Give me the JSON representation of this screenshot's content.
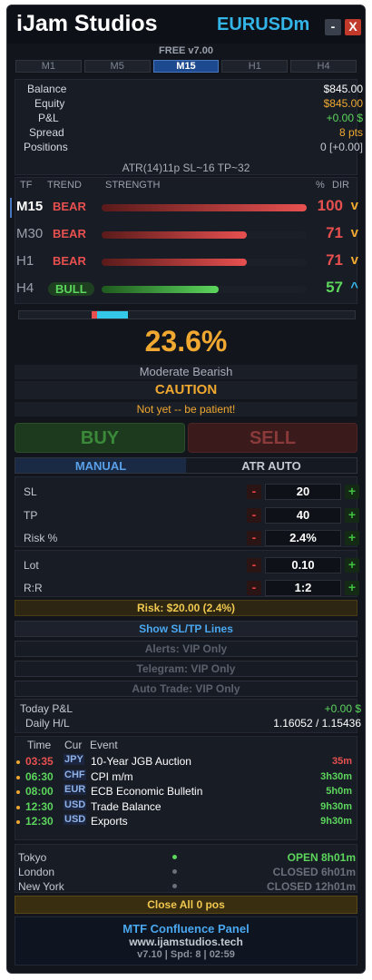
{
  "header": {
    "title": "iJam Studios",
    "symbol": "EURUSDm",
    "minimize_label": "-",
    "close_label": "X"
  },
  "version_label": "FREE v7.00",
  "timeframe_tabs": [
    {
      "label": "M1",
      "active": false
    },
    {
      "label": "M5",
      "active": false
    },
    {
      "label": "M15",
      "active": true
    },
    {
      "label": "H1",
      "active": false
    },
    {
      "label": "H4",
      "active": false
    }
  ],
  "account": {
    "balance_label": "Balance",
    "balance": "$845.00",
    "equity_label": "Equity",
    "equity": "$845.00",
    "pl_label": "P&L",
    "pl": "+0.00 $",
    "spread_label": "Spread",
    "spread": "8 pts",
    "positions_label": "Positions",
    "positions": "0 [+0.00]",
    "atr_line": "ATR(14)11p   SL~16   TP~32"
  },
  "trend_table": {
    "headers": {
      "tf": "TF",
      "trend": "TREND",
      "strength": "STRENGTH",
      "pct": "%",
      "dir": "DIR"
    },
    "rows": [
      {
        "tf": "M15",
        "trend": "BEAR",
        "strength_pct": 100,
        "pct": "100",
        "dir": "v",
        "selected": true
      },
      {
        "tf": "M30",
        "trend": "BEAR",
        "strength_pct": 71,
        "pct": "71",
        "dir": "v",
        "selected": false
      },
      {
        "tf": "H1",
        "trend": "BEAR",
        "strength_pct": 71,
        "pct": "71",
        "dir": "v",
        "selected": false
      },
      {
        "tf": "H4",
        "trend": "BULL",
        "strength_pct": 57,
        "pct": "57",
        "dir": "^",
        "selected": false
      }
    ]
  },
  "confluence": {
    "gauge_value_pct": 23.6,
    "percent": "23.6%",
    "bias": "Moderate Bearish",
    "signal": "CAUTION",
    "advice": "Not yet -- be patient!"
  },
  "trade": {
    "buy_label": "BUY",
    "sell_label": "SELL"
  },
  "mode_tabs": [
    {
      "label": "MANUAL",
      "active": true
    },
    {
      "label": "ATR AUTO",
      "active": false
    }
  ],
  "params": [
    {
      "label": "SL",
      "value": "20"
    },
    {
      "label": "TP",
      "value": "40"
    },
    {
      "label": "Risk %",
      "value": "2.4%"
    },
    {
      "label": "Lot",
      "value": "0.10"
    },
    {
      "label": "R:R",
      "value": "1:2"
    }
  ],
  "param_buttons": {
    "minus": "-",
    "plus": "+"
  },
  "risk_summary": "Risk: $20.00 (2.4%)",
  "show_lines_label": "Show SL/TP Lines",
  "vip_features": [
    "Alerts: VIP Only",
    "Telegram: VIP Only",
    "Auto Trade: VIP Only"
  ],
  "stats": {
    "today_pl_label": "Today P&L",
    "today_pl": "+0.00 $",
    "daily_hl_label": "Daily H/L",
    "daily_hl": "1.16052 / 1.15436"
  },
  "events": {
    "headers": {
      "time": "Time",
      "cur": "Cur",
      "event": "Event"
    },
    "rows": [
      {
        "time": "03:35",
        "cur": "JPY",
        "event": "10-Year JGB Auction",
        "remaining": "35m",
        "urgent": true
      },
      {
        "time": "06:30",
        "cur": "CHF",
        "event": "CPI m/m",
        "remaining": "3h30m",
        "urgent": false
      },
      {
        "time": "08:00",
        "cur": "EUR",
        "event": "ECB Economic Bulletin",
        "remaining": "5h0m",
        "urgent": false
      },
      {
        "time": "12:30",
        "cur": "USD",
        "event": "Trade Balance",
        "remaining": "9h30m",
        "urgent": false
      },
      {
        "time": "12:30",
        "cur": "USD",
        "event": "Exports",
        "remaining": "9h30m",
        "urgent": false
      }
    ]
  },
  "sessions": [
    {
      "name": "Tokyo",
      "status": "OPEN  8h01m",
      "open": true
    },
    {
      "name": "London",
      "status": "CLOSED  6h01m",
      "open": false
    },
    {
      "name": "New York",
      "status": "CLOSED  12h01m",
      "open": false
    }
  ],
  "close_all_label": "Close All 0 pos",
  "footer": {
    "name": "MTF Confluence Panel",
    "url": "www.ijamstudios.tech",
    "info": "v7.10  |  Spd: 8  |  02:59"
  },
  "colors": {
    "bear": "#e85050",
    "bull": "#5cd65c",
    "accent": "#34b5e8",
    "gold": "#f0a830"
  }
}
